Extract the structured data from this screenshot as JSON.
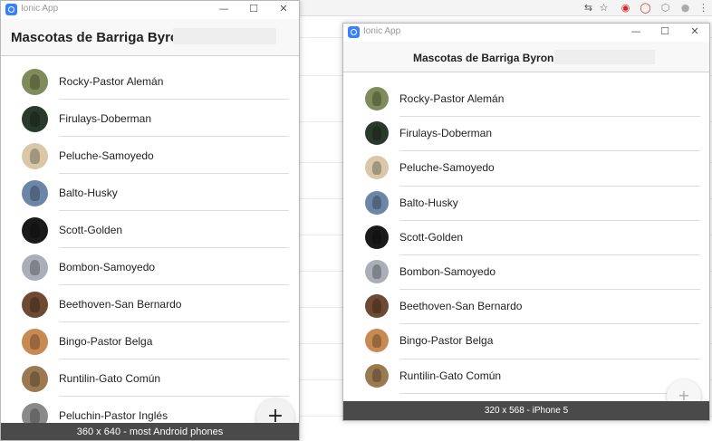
{
  "colors": {
    "ionic_primary": "#3880ff",
    "device_bar": "#4a4a4a",
    "header_bg": "#f8f8f8"
  },
  "browser_toolbar": {
    "icons": [
      "translate-icon",
      "star-icon",
      "extension-red-icon",
      "opera-icon",
      "extension-shield-icon",
      "extension-gray-icon",
      "menu-icon"
    ]
  },
  "windows": [
    {
      "id": "android",
      "titlebar": {
        "app_name": "Ionic App"
      },
      "header": {
        "title": "Mascotas de Barriga Byron"
      },
      "fab_label": "+",
      "device_label": "360 x 640 - most Android phones",
      "items": [
        {
          "label": "Rocky-Pastor Alemán",
          "avatar_color": "#7f8b5a"
        },
        {
          "label": "Firulays-Doberman",
          "avatar_color": "#2a3a2a"
        },
        {
          "label": "Peluche-Samoyedo",
          "avatar_color": "#d9c7a8"
        },
        {
          "label": "Balto-Husky",
          "avatar_color": "#6c86a8"
        },
        {
          "label": "Scott-Golden",
          "avatar_color": "#1a1a1a"
        },
        {
          "label": "Bombon-Samoyedo",
          "avatar_color": "#a9aeb8"
        },
        {
          "label": "Beethoven-San Bernardo",
          "avatar_color": "#6e4a32"
        },
        {
          "label": "Bingo-Pastor Belga",
          "avatar_color": "#c98a52"
        },
        {
          "label": "Runtilin-Gato Común",
          "avatar_color": "#9b7a52"
        },
        {
          "label": "Peluchin-Pastor Inglés",
          "avatar_color": "#8a8a8a"
        }
      ]
    },
    {
      "id": "iphone",
      "titlebar": {
        "app_name": "Ionic App"
      },
      "header": {
        "title": "Mascotas de Barriga Byron"
      },
      "fab_label": "+",
      "device_label": "320 x 568 - iPhone 5",
      "items": [
        {
          "label": "Rocky-Pastor Alemán",
          "avatar_color": "#7f8b5a"
        },
        {
          "label": "Firulays-Doberman",
          "avatar_color": "#2a3a2a"
        },
        {
          "label": "Peluche-Samoyedo",
          "avatar_color": "#d9c7a8"
        },
        {
          "label": "Balto-Husky",
          "avatar_color": "#6c86a8"
        },
        {
          "label": "Scott-Golden",
          "avatar_color": "#1a1a1a"
        },
        {
          "label": "Bombon-Samoyedo",
          "avatar_color": "#a9aeb8"
        },
        {
          "label": "Beethoven-San Bernardo",
          "avatar_color": "#6e4a32"
        },
        {
          "label": "Bingo-Pastor Belga",
          "avatar_color": "#c98a52"
        },
        {
          "label": "Runtilin-Gato Común",
          "avatar_color": "#9b7a52"
        }
      ]
    }
  ]
}
